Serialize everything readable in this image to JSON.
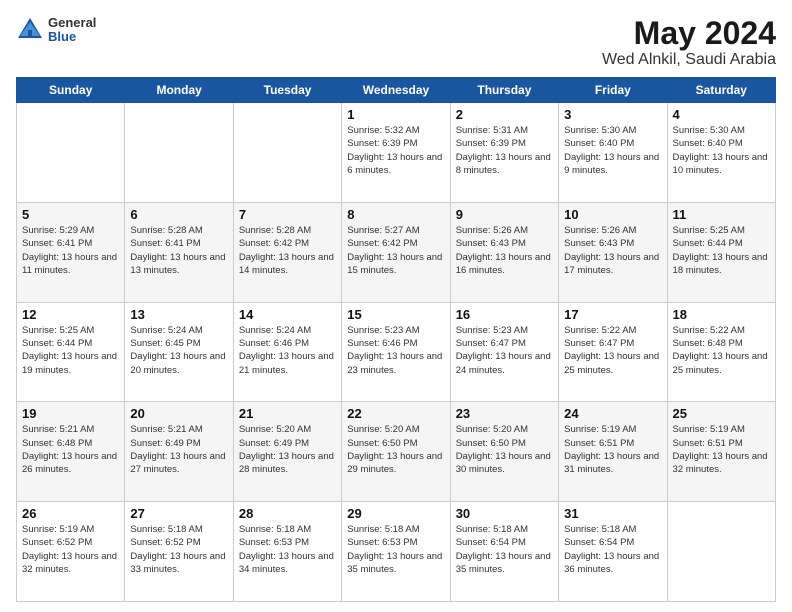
{
  "logo": {
    "general": "General",
    "blue": "Blue"
  },
  "header": {
    "title": "May 2024",
    "subtitle": "Wed Alnkil, Saudi Arabia"
  },
  "weekdays": [
    "Sunday",
    "Monday",
    "Tuesday",
    "Wednesday",
    "Thursday",
    "Friday",
    "Saturday"
  ],
  "weeks": [
    [
      {
        "day": "",
        "info": ""
      },
      {
        "day": "",
        "info": ""
      },
      {
        "day": "",
        "info": ""
      },
      {
        "day": "1",
        "info": "Sunrise: 5:32 AM\nSunset: 6:39 PM\nDaylight: 13 hours\nand 6 minutes."
      },
      {
        "day": "2",
        "info": "Sunrise: 5:31 AM\nSunset: 6:39 PM\nDaylight: 13 hours\nand 8 minutes."
      },
      {
        "day": "3",
        "info": "Sunrise: 5:30 AM\nSunset: 6:40 PM\nDaylight: 13 hours\nand 9 minutes."
      },
      {
        "day": "4",
        "info": "Sunrise: 5:30 AM\nSunset: 6:40 PM\nDaylight: 13 hours\nand 10 minutes."
      }
    ],
    [
      {
        "day": "5",
        "info": "Sunrise: 5:29 AM\nSunset: 6:41 PM\nDaylight: 13 hours\nand 11 minutes."
      },
      {
        "day": "6",
        "info": "Sunrise: 5:28 AM\nSunset: 6:41 PM\nDaylight: 13 hours\nand 13 minutes."
      },
      {
        "day": "7",
        "info": "Sunrise: 5:28 AM\nSunset: 6:42 PM\nDaylight: 13 hours\nand 14 minutes."
      },
      {
        "day": "8",
        "info": "Sunrise: 5:27 AM\nSunset: 6:42 PM\nDaylight: 13 hours\nand 15 minutes."
      },
      {
        "day": "9",
        "info": "Sunrise: 5:26 AM\nSunset: 6:43 PM\nDaylight: 13 hours\nand 16 minutes."
      },
      {
        "day": "10",
        "info": "Sunrise: 5:26 AM\nSunset: 6:43 PM\nDaylight: 13 hours\nand 17 minutes."
      },
      {
        "day": "11",
        "info": "Sunrise: 5:25 AM\nSunset: 6:44 PM\nDaylight: 13 hours\nand 18 minutes."
      }
    ],
    [
      {
        "day": "12",
        "info": "Sunrise: 5:25 AM\nSunset: 6:44 PM\nDaylight: 13 hours\nand 19 minutes."
      },
      {
        "day": "13",
        "info": "Sunrise: 5:24 AM\nSunset: 6:45 PM\nDaylight: 13 hours\nand 20 minutes."
      },
      {
        "day": "14",
        "info": "Sunrise: 5:24 AM\nSunset: 6:46 PM\nDaylight: 13 hours\nand 21 minutes."
      },
      {
        "day": "15",
        "info": "Sunrise: 5:23 AM\nSunset: 6:46 PM\nDaylight: 13 hours\nand 23 minutes."
      },
      {
        "day": "16",
        "info": "Sunrise: 5:23 AM\nSunset: 6:47 PM\nDaylight: 13 hours\nand 24 minutes."
      },
      {
        "day": "17",
        "info": "Sunrise: 5:22 AM\nSunset: 6:47 PM\nDaylight: 13 hours\nand 25 minutes."
      },
      {
        "day": "18",
        "info": "Sunrise: 5:22 AM\nSunset: 6:48 PM\nDaylight: 13 hours\nand 25 minutes."
      }
    ],
    [
      {
        "day": "19",
        "info": "Sunrise: 5:21 AM\nSunset: 6:48 PM\nDaylight: 13 hours\nand 26 minutes."
      },
      {
        "day": "20",
        "info": "Sunrise: 5:21 AM\nSunset: 6:49 PM\nDaylight: 13 hours\nand 27 minutes."
      },
      {
        "day": "21",
        "info": "Sunrise: 5:20 AM\nSunset: 6:49 PM\nDaylight: 13 hours\nand 28 minutes."
      },
      {
        "day": "22",
        "info": "Sunrise: 5:20 AM\nSunset: 6:50 PM\nDaylight: 13 hours\nand 29 minutes."
      },
      {
        "day": "23",
        "info": "Sunrise: 5:20 AM\nSunset: 6:50 PM\nDaylight: 13 hours\nand 30 minutes."
      },
      {
        "day": "24",
        "info": "Sunrise: 5:19 AM\nSunset: 6:51 PM\nDaylight: 13 hours\nand 31 minutes."
      },
      {
        "day": "25",
        "info": "Sunrise: 5:19 AM\nSunset: 6:51 PM\nDaylight: 13 hours\nand 32 minutes."
      }
    ],
    [
      {
        "day": "26",
        "info": "Sunrise: 5:19 AM\nSunset: 6:52 PM\nDaylight: 13 hours\nand 32 minutes."
      },
      {
        "day": "27",
        "info": "Sunrise: 5:18 AM\nSunset: 6:52 PM\nDaylight: 13 hours\nand 33 minutes."
      },
      {
        "day": "28",
        "info": "Sunrise: 5:18 AM\nSunset: 6:53 PM\nDaylight: 13 hours\nand 34 minutes."
      },
      {
        "day": "29",
        "info": "Sunrise: 5:18 AM\nSunset: 6:53 PM\nDaylight: 13 hours\nand 35 minutes."
      },
      {
        "day": "30",
        "info": "Sunrise: 5:18 AM\nSunset: 6:54 PM\nDaylight: 13 hours\nand 35 minutes."
      },
      {
        "day": "31",
        "info": "Sunrise: 5:18 AM\nSunset: 6:54 PM\nDaylight: 13 hours\nand 36 minutes."
      },
      {
        "day": "",
        "info": ""
      }
    ]
  ]
}
